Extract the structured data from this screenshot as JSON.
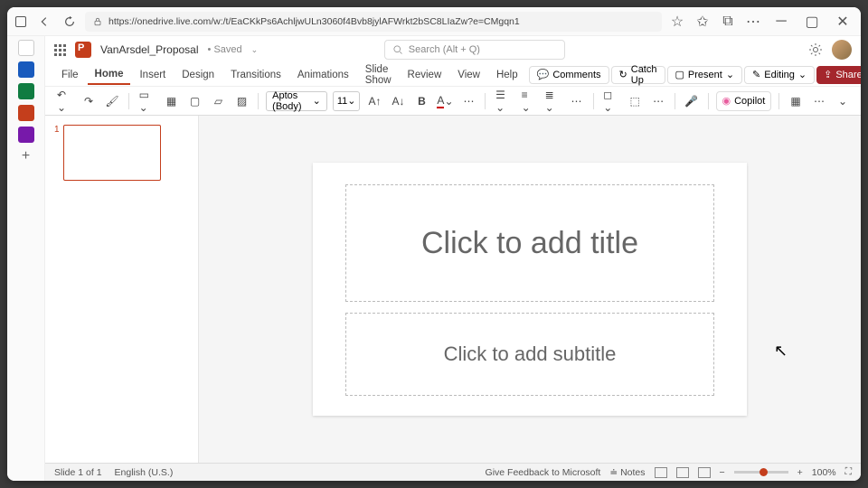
{
  "browser": {
    "url": "https://onedrive.live.com/w:/t/EaCKkPs6AchljwULn3060f4Bvb8jylAFWrkt2bSC8LIaZw?e=CMgqn1"
  },
  "app": {
    "doc_name": "VanArsdel_Proposal",
    "save_state": "Saved",
    "search_placeholder": "Search (Alt + Q)"
  },
  "ribbon": {
    "tabs": [
      "File",
      "Home",
      "Insert",
      "Design",
      "Transitions",
      "Animations",
      "Slide Show",
      "Review",
      "View",
      "Help"
    ],
    "active": "Home",
    "right": {
      "comments": "Comments",
      "catchup": "Catch Up",
      "present": "Present",
      "editing": "Editing",
      "share": "Share"
    }
  },
  "toolbar": {
    "font_name": "Aptos (Body)",
    "font_size": "11",
    "copilot": "Copilot"
  },
  "slide": {
    "title_placeholder": "Click to add title",
    "subtitle_placeholder": "Click to add subtitle"
  },
  "thumbnails": {
    "slide1_num": "1"
  },
  "status": {
    "slide_info": "Slide 1 of 1",
    "lang": "English (U.S.)",
    "feedback": "Give Feedback to Microsoft",
    "notes": "Notes",
    "zoom": "100%"
  }
}
